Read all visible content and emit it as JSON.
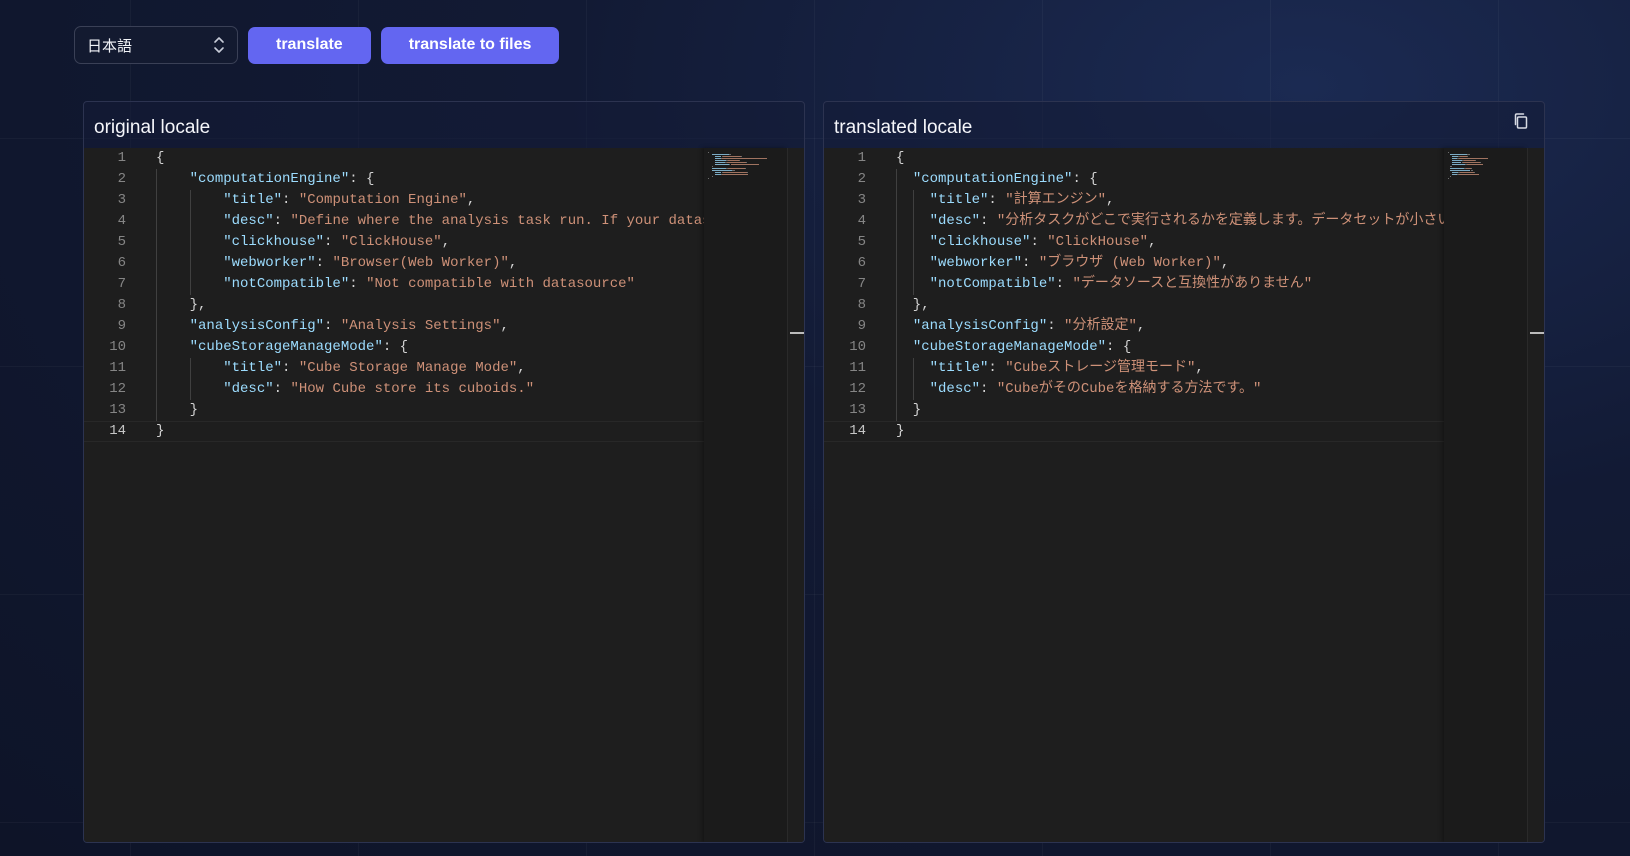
{
  "toolbar": {
    "language": "日本語",
    "translate_label": "translate",
    "translate_files_label": "translate to files"
  },
  "original": {
    "title": "original locale",
    "lines": [
      [
        [
          "p",
          "{"
        ]
      ],
      [
        [
          "p",
          "    "
        ],
        [
          "k",
          "\"computationEngine\""
        ],
        [
          "p",
          ": {"
        ]
      ],
      [
        [
          "p",
          "        "
        ],
        [
          "k",
          "\"title\""
        ],
        [
          "p",
          ": "
        ],
        [
          "s",
          "\"Computation Engine\""
        ],
        [
          "p",
          ","
        ]
      ],
      [
        [
          "p",
          "        "
        ],
        [
          "k",
          "\"desc\""
        ],
        [
          "p",
          ": "
        ],
        [
          "s",
          "\"Define where the analysis task run. If your datas"
        ]
      ],
      [
        [
          "p",
          "        "
        ],
        [
          "k",
          "\"clickhouse\""
        ],
        [
          "p",
          ": "
        ],
        [
          "s",
          "\"ClickHouse\""
        ],
        [
          "p",
          ","
        ]
      ],
      [
        [
          "p",
          "        "
        ],
        [
          "k",
          "\"webworker\""
        ],
        [
          "p",
          ": "
        ],
        [
          "s",
          "\"Browser(Web Worker)\""
        ],
        [
          "p",
          ","
        ]
      ],
      [
        [
          "p",
          "        "
        ],
        [
          "k",
          "\"notCompatible\""
        ],
        [
          "p",
          ": "
        ],
        [
          "s",
          "\"Not compatible with datasource\""
        ]
      ],
      [
        [
          "p",
          "    },"
        ]
      ],
      [
        [
          "p",
          "    "
        ],
        [
          "k",
          "\"analysisConfig\""
        ],
        [
          "p",
          ": "
        ],
        [
          "s",
          "\"Analysis Settings\""
        ],
        [
          "p",
          ","
        ]
      ],
      [
        [
          "p",
          "    "
        ],
        [
          "k",
          "\"cubeStorageManageMode\""
        ],
        [
          "p",
          ": {"
        ]
      ],
      [
        [
          "p",
          "        "
        ],
        [
          "k",
          "\"title\""
        ],
        [
          "p",
          ": "
        ],
        [
          "s",
          "\"Cube Storage Manage Mode\""
        ],
        [
          "p",
          ","
        ]
      ],
      [
        [
          "p",
          "        "
        ],
        [
          "k",
          "\"desc\""
        ],
        [
          "p",
          ": "
        ],
        [
          "s",
          "\"How Cube store its cuboids.\""
        ]
      ],
      [
        [
          "p",
          "    }"
        ]
      ],
      [
        [
          "p",
          "}"
        ]
      ]
    ]
  },
  "translated": {
    "title": "translated locale",
    "lines": [
      [
        [
          "p",
          "{"
        ]
      ],
      [
        [
          "p",
          "  "
        ],
        [
          "k",
          "\"computationEngine\""
        ],
        [
          "p",
          ": {"
        ]
      ],
      [
        [
          "p",
          "    "
        ],
        [
          "k",
          "\"title\""
        ],
        [
          "p",
          ": "
        ],
        [
          "s",
          "\"計算エンジン\""
        ],
        [
          "p",
          ","
        ]
      ],
      [
        [
          "p",
          "    "
        ],
        [
          "k",
          "\"desc\""
        ],
        [
          "p",
          ": "
        ],
        [
          "s",
          "\"分析タスクがどこで実行されるかを定義します。データセットが小さい"
        ]
      ],
      [
        [
          "p",
          "    "
        ],
        [
          "k",
          "\"clickhouse\""
        ],
        [
          "p",
          ": "
        ],
        [
          "s",
          "\"ClickHouse\""
        ],
        [
          "p",
          ","
        ]
      ],
      [
        [
          "p",
          "    "
        ],
        [
          "k",
          "\"webworker\""
        ],
        [
          "p",
          ": "
        ],
        [
          "s",
          "\"ブラウザ (Web Worker)\""
        ],
        [
          "p",
          ","
        ]
      ],
      [
        [
          "p",
          "    "
        ],
        [
          "k",
          "\"notCompatible\""
        ],
        [
          "p",
          ": "
        ],
        [
          "s",
          "\"データソースと互換性がありません\""
        ]
      ],
      [
        [
          "p",
          "  },"
        ]
      ],
      [
        [
          "p",
          "  "
        ],
        [
          "k",
          "\"analysisConfig\""
        ],
        [
          "p",
          ": "
        ],
        [
          "s",
          "\"分析設定\""
        ],
        [
          "p",
          ","
        ]
      ],
      [
        [
          "p",
          "  "
        ],
        [
          "k",
          "\"cubeStorageManageMode\""
        ],
        [
          "p",
          ": {"
        ]
      ],
      [
        [
          "p",
          "    "
        ],
        [
          "k",
          "\"title\""
        ],
        [
          "p",
          ": "
        ],
        [
          "s",
          "\"Cubeストレージ管理モード\""
        ],
        [
          "p",
          ","
        ]
      ],
      [
        [
          "p",
          "    "
        ],
        [
          "k",
          "\"desc\""
        ],
        [
          "p",
          ": "
        ],
        [
          "s",
          "\"CubeがそのCubeを格納する方法です。\""
        ]
      ],
      [
        [
          "p",
          "  }"
        ]
      ],
      [
        [
          "p",
          "}"
        ]
      ]
    ]
  },
  "active_line": 14,
  "colors": {
    "accent": "#6366f1",
    "editor_bg": "#1e1e1e",
    "key": "#9cdcfe",
    "string": "#ce9178"
  }
}
